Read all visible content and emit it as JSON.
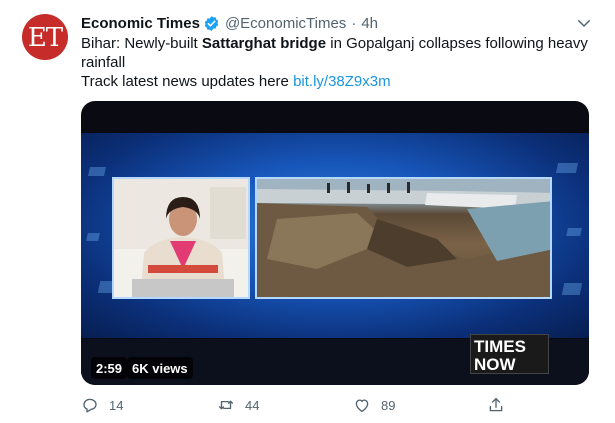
{
  "author": {
    "avatar_text": "ET",
    "name": "Economic Times",
    "handle": "@EconomicTimes",
    "separator": "·",
    "time": "4h"
  },
  "tweet": {
    "text_prefix": "Bihar: Newly-built ",
    "text_bold": "Sattarghat bridge",
    "text_suffix": " in Gopalganj collapses following heavy",
    "text_line2": "rainfall",
    "link_prefix": "Track latest news updates here ",
    "link_text": "bit.ly/38Z9x3m"
  },
  "media": {
    "duration": "2:59",
    "views": "6K views",
    "channel_logo_top": "TIMES",
    "channel_logo_bottom": "NOW"
  },
  "actions": {
    "replies": "14",
    "retweets": "44",
    "likes": "89"
  },
  "colors": {
    "link": "#1b95e0",
    "verified": "#1da1f2",
    "muted": "#536471",
    "avatar_bg": "#c62d2a"
  },
  "icons": [
    "verified-badge-icon",
    "chevron-down-icon",
    "reply-icon",
    "retweet-icon",
    "like-icon",
    "share-icon"
  ]
}
